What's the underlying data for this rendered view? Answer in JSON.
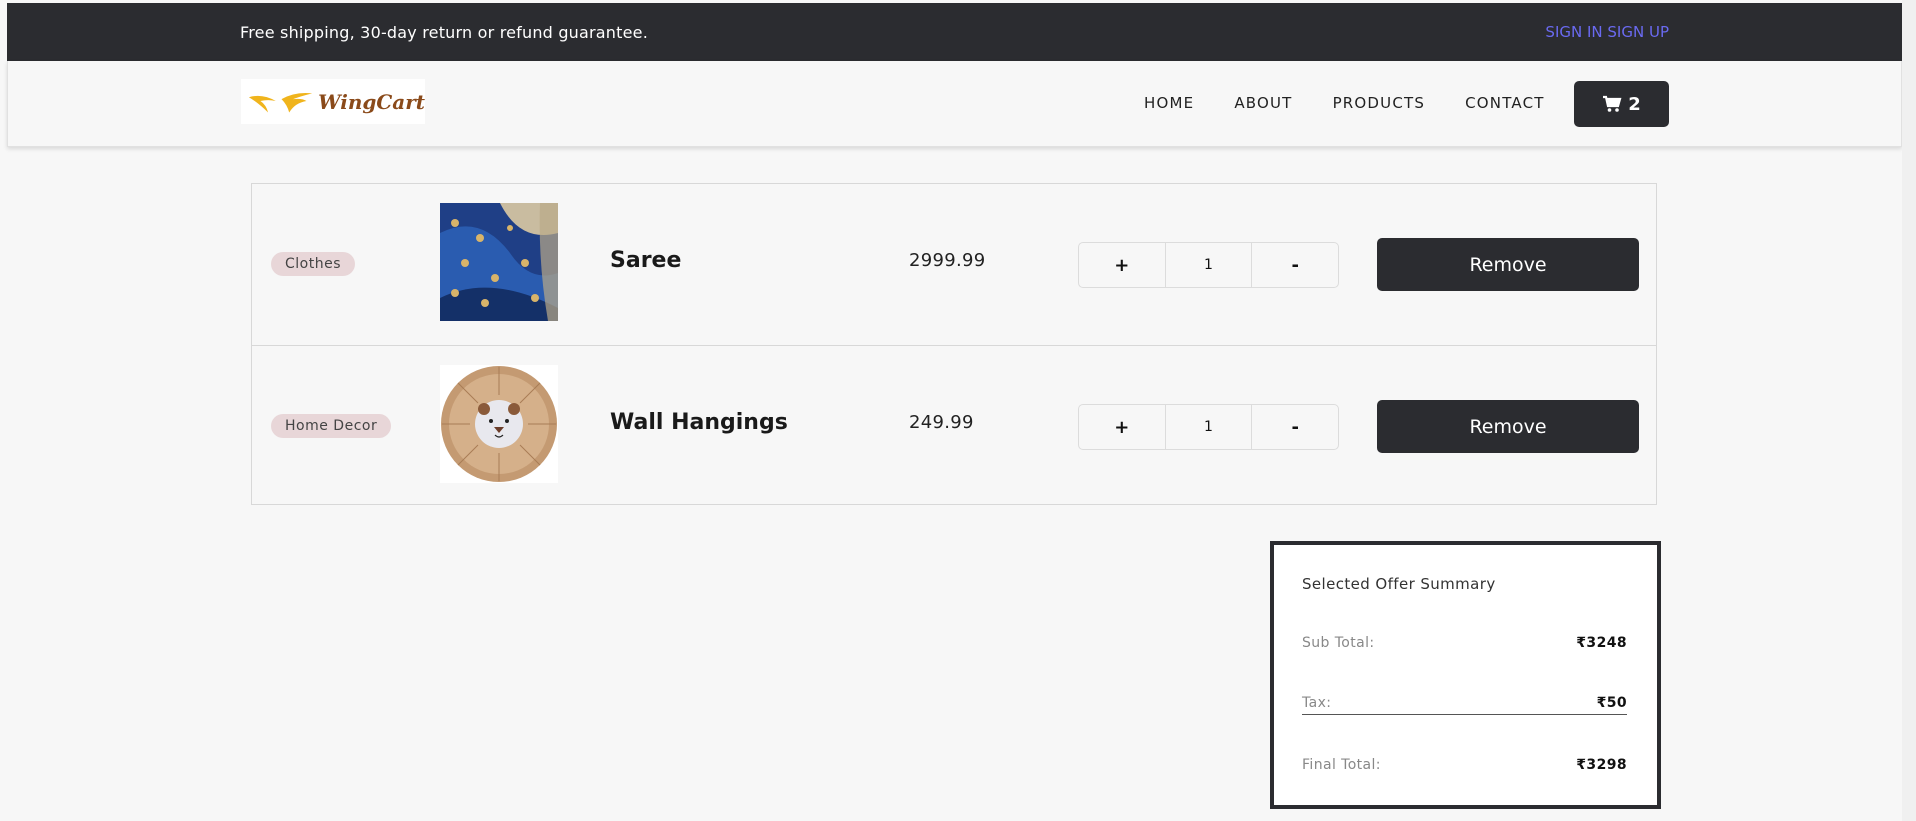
{
  "topbar": {
    "promo": "Free shipping, 30-day return or refund guarantee.",
    "sign_in": "SIGN IN",
    "sign_up": "SIGN UP"
  },
  "nav": {
    "logo_text": "WingCart",
    "links": [
      "HOME",
      "ABOUT",
      "PRODUCTS",
      "CONTACT"
    ],
    "cart_count": "2"
  },
  "cart": {
    "items": [
      {
        "category": "Clothes",
        "name": "Saree",
        "price": "2999.99",
        "qty": "1",
        "plus": "+",
        "minus": "-",
        "remove": "Remove"
      },
      {
        "category": "Home Decor",
        "name": "Wall Hangings",
        "price": "249.99",
        "qty": "1",
        "plus": "+",
        "minus": "-",
        "remove": "Remove"
      }
    ]
  },
  "summary": {
    "title": "Selected Offer Summary",
    "subtotal_label": "Sub Total:",
    "subtotal_value": "₹3248",
    "tax_label": "Tax:",
    "tax_value": "₹50",
    "final_label": "Final Total:",
    "final_value": "₹3298"
  },
  "colors": {
    "dark": "#2b2c30",
    "auth_link": "#6a6af0",
    "badge": "#e8d6d8",
    "logo_wing": "#f0b41c",
    "logo_text": "#8a4a1a"
  }
}
